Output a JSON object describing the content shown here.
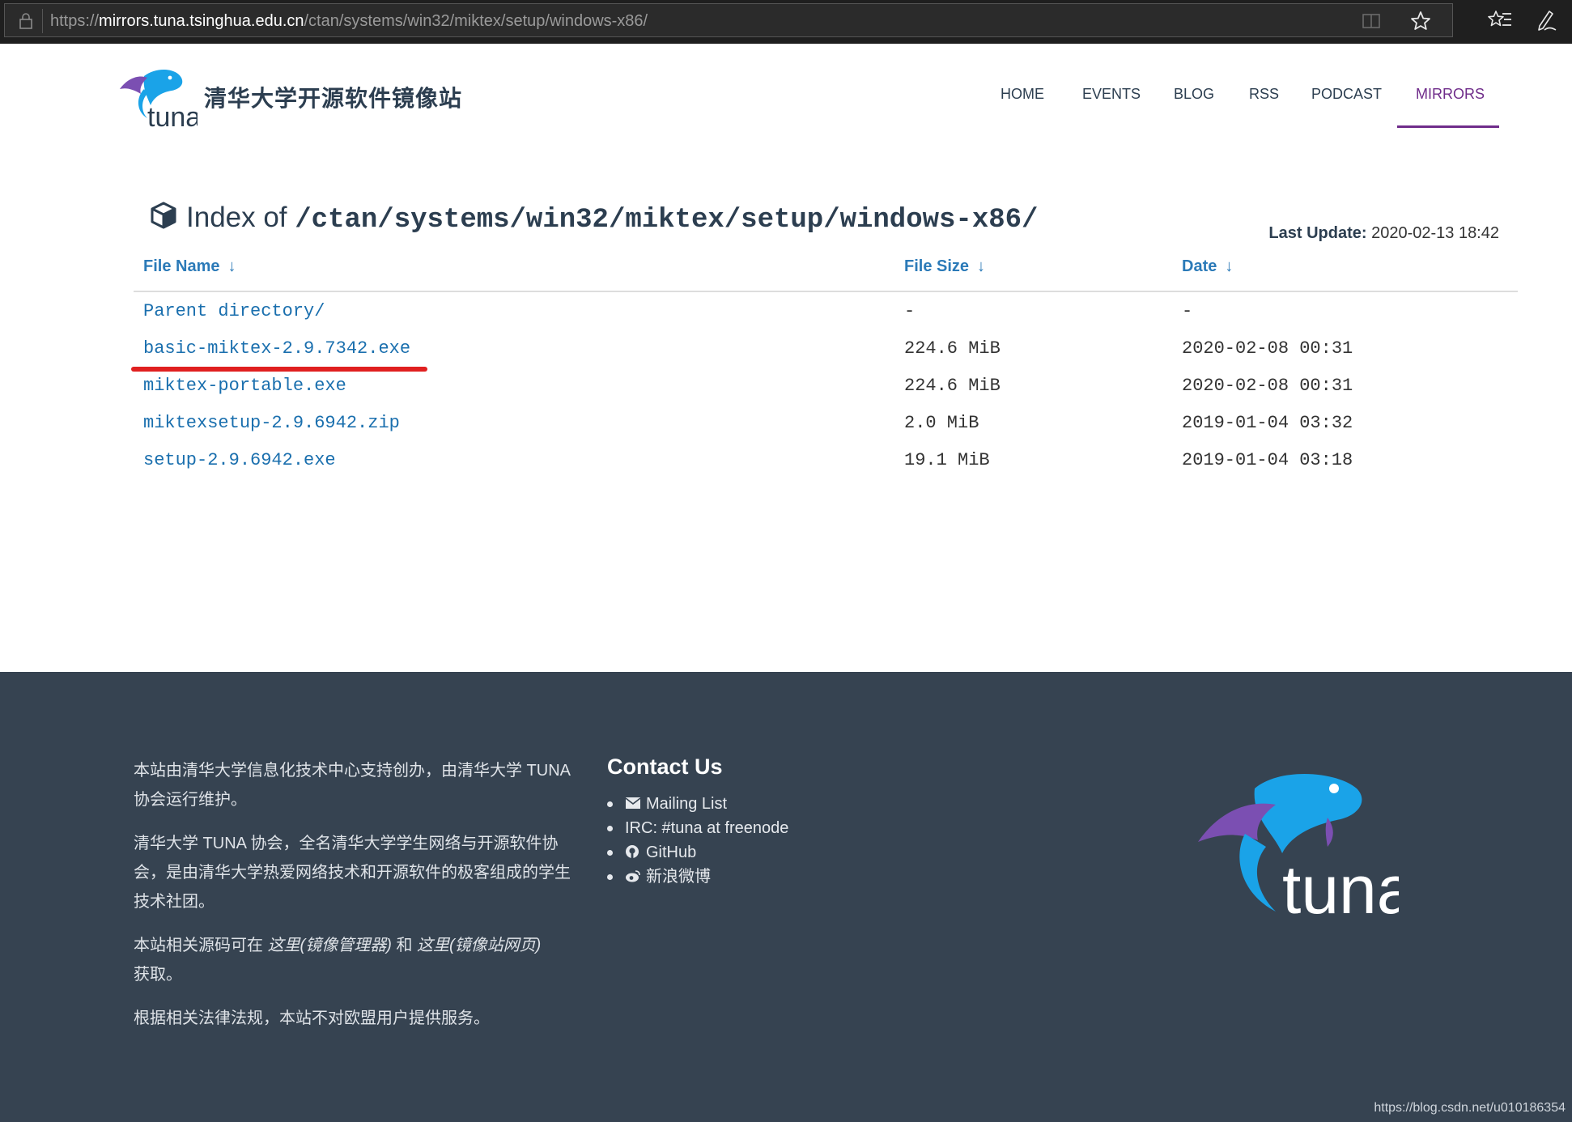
{
  "browser": {
    "url_prefix": "https://",
    "url_host": "mirrors.tuna.tsinghua.edu.cn",
    "url_path": "/ctan/systems/win32/miktex/setup/windows-x86/",
    "icons": [
      "lock-icon",
      "reading-view-icon",
      "favorite-star-icon",
      "favorites-list-icon",
      "pen-notes-icon"
    ]
  },
  "header": {
    "site_title": "清华大学开源软件镜像站",
    "logo_text": "tuna",
    "nav": [
      "HOME",
      "EVENTS",
      "BLOG",
      "RSS",
      "PODCAST",
      "MIRRORS"
    ],
    "active_nav": "MIRRORS",
    "accent_color": "#6f2c8a"
  },
  "index": {
    "title_prefix": "Index of",
    "path": "/ctan/systems/win32/miktex/setup/windows-x86/",
    "last_update_label": "Last Update:",
    "last_update_value": "2020-02-13 18:42",
    "columns": [
      "File Name",
      "File Size",
      "Date"
    ],
    "sort_arrow": "↓",
    "rows": [
      {
        "name": "Parent directory/",
        "size": "-",
        "date": "-"
      },
      {
        "name": "basic-miktex-2.9.7342.exe",
        "size": "224.6 MiB",
        "date": "2020-02-08 00:31"
      },
      {
        "name": "miktex-portable.exe",
        "size": "224.6 MiB",
        "date": "2020-02-08 00:31"
      },
      {
        "name": "miktexsetup-2.9.6942.zip",
        "size": "2.0 MiB",
        "date": "2019-01-04 03:32"
      },
      {
        "name": "setup-2.9.6942.exe",
        "size": "19.1 MiB",
        "date": "2019-01-04 03:18"
      }
    ],
    "link_color": "#1a6fae",
    "highlight_color": "#e02020"
  },
  "footer": {
    "about_1": "本站由清华大学信息化技术中心支持创办，由清华大学 TUNA 协会运行维护。",
    "about_2": "清华大学 TUNA 协会，全名清华大学学生网络与开源软件协会，是由清华大学热爱网络技术和开源软件的极客组成的学生技术社团。",
    "about_3_prefix": "本站相关源码可在 ",
    "about_3_link1": "这里(镜像管理器)",
    "about_3_mid": " 和 ",
    "about_3_link2": "这里(镜像站网页)",
    "about_3_suffix": "获取。",
    "about_4": "根据相关法律法规，本站不对欧盟用户提供服务。",
    "contact_title": "Contact Us",
    "contacts": [
      "Mailing List",
      "IRC: #tuna at freenode",
      "GitHub",
      "新浪微博"
    ],
    "logo_text": "tuna",
    "background": "#364351"
  },
  "watermark": "https://blog.csdn.net/u010186354"
}
